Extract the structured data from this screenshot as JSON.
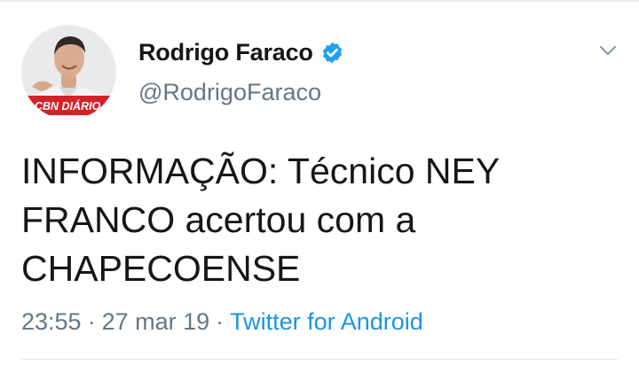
{
  "user": {
    "name": "Rodrigo Faraco",
    "handle": "@RodrigoFaraco",
    "avatar_banner_text": "CBN DIÁRIO"
  },
  "tweet": {
    "lines": [
      "INFORMAÇÃO: Técnico NEY",
      "FRANCO acertou com a",
      "CHAPECOENSE"
    ],
    "time": "23:55",
    "separator": "·",
    "date": "27 mar 19",
    "source": "Twitter for Android"
  },
  "icons": {
    "verified": "verified-badge-icon",
    "menu": "chevron-down-icon"
  },
  "colors": {
    "text": "#14171a",
    "secondary": "#657786",
    "link": "#1b95e0",
    "verified": "#1da1f2"
  }
}
